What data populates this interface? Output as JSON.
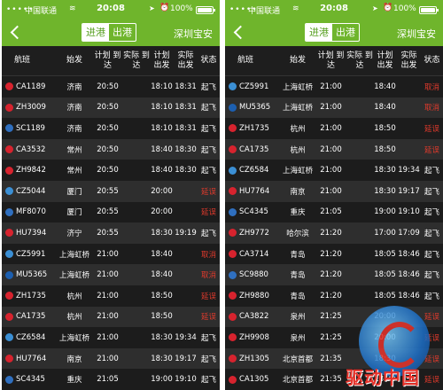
{
  "statusbar": {
    "signal": "•••••",
    "carrier": "中国联通",
    "wifi": "≋",
    "time": "20:08",
    "location": "➤",
    "alarm": "⏰",
    "battery": "100%",
    "battery_level": 1.0
  },
  "nav": {
    "tab_arrive": "进港",
    "tab_depart": "出港",
    "airport": "深圳宝安"
  },
  "columns": {
    "flight": "航班",
    "origin": "始发",
    "sched_arr": "计划 到达",
    "actual_arr": "实际 到达",
    "sched_dep": "计划 出发",
    "actual_dep": "实际 出发",
    "status": "状态"
  },
  "airline_colors": {
    "CA": "#d7232e",
    "ZH": "#d7232e",
    "SC": "#2f6fbf",
    "CZ": "#3b8fd4",
    "MF": "#2f6fbf",
    "HU": "#d7232e",
    "MU": "#1c5fb0"
  },
  "left_flights": [
    {
      "flight": "CA1189",
      "origin": "济南",
      "sched_arr": "20:50",
      "actual_arr": "",
      "sched_dep": "18:10",
      "actual_dep": "18:31",
      "status": "起飞",
      "status_color": "white",
      "airline": "CA"
    },
    {
      "flight": "ZH3009",
      "origin": "济南",
      "sched_arr": "20:50",
      "actual_arr": "",
      "sched_dep": "18:10",
      "actual_dep": "18:31",
      "status": "起飞",
      "status_color": "white",
      "airline": "ZH"
    },
    {
      "flight": "SC1189",
      "origin": "济南",
      "sched_arr": "20:50",
      "actual_arr": "",
      "sched_dep": "18:10",
      "actual_dep": "18:31",
      "status": "起飞",
      "status_color": "white",
      "airline": "SC"
    },
    {
      "flight": "CA3532",
      "origin": "常州",
      "sched_arr": "20:50",
      "actual_arr": "",
      "sched_dep": "18:40",
      "actual_dep": "18:30",
      "status": "起飞",
      "status_color": "white",
      "airline": "CA"
    },
    {
      "flight": "ZH9842",
      "origin": "常州",
      "sched_arr": "20:50",
      "actual_arr": "",
      "sched_dep": "18:40",
      "actual_dep": "18:30",
      "status": "起飞",
      "status_color": "white",
      "airline": "ZH"
    },
    {
      "flight": "CZ5044",
      "origin": "厦门",
      "sched_arr": "20:55",
      "actual_arr": "",
      "sched_dep": "20:00",
      "actual_dep": "",
      "status": "延误",
      "status_color": "red",
      "airline": "CZ"
    },
    {
      "flight": "MF8070",
      "origin": "厦门",
      "sched_arr": "20:55",
      "actual_arr": "",
      "sched_dep": "20:00",
      "actual_dep": "",
      "status": "延误",
      "status_color": "red",
      "airline": "MF"
    },
    {
      "flight": "HU7394",
      "origin": "济宁",
      "sched_arr": "20:55",
      "actual_arr": "",
      "sched_dep": "18:30",
      "actual_dep": "19:19",
      "status": "起飞",
      "status_color": "white",
      "airline": "HU"
    },
    {
      "flight": "CZ5991",
      "origin": "上海虹桥",
      "sched_arr": "21:00",
      "actual_arr": "",
      "sched_dep": "18:40",
      "actual_dep": "",
      "status": "取消",
      "status_color": "red",
      "airline": "CZ"
    },
    {
      "flight": "MU5365",
      "origin": "上海虹桥",
      "sched_arr": "21:00",
      "actual_arr": "",
      "sched_dep": "18:40",
      "actual_dep": "",
      "status": "取消",
      "status_color": "red",
      "airline": "MU"
    },
    {
      "flight": "ZH1735",
      "origin": "杭州",
      "sched_arr": "21:00",
      "actual_arr": "",
      "sched_dep": "18:50",
      "actual_dep": "",
      "status": "延误",
      "status_color": "red",
      "airline": "ZH"
    },
    {
      "flight": "CA1735",
      "origin": "杭州",
      "sched_arr": "21:00",
      "actual_arr": "",
      "sched_dep": "18:50",
      "actual_dep": "",
      "status": "延误",
      "status_color": "red",
      "airline": "CA"
    },
    {
      "flight": "CZ6584",
      "origin": "上海虹桥",
      "sched_arr": "21:00",
      "actual_arr": "",
      "sched_dep": "18:30",
      "actual_dep": "19:34",
      "status": "起飞",
      "status_color": "white",
      "airline": "CZ"
    },
    {
      "flight": "HU7764",
      "origin": "南京",
      "sched_arr": "21:00",
      "actual_arr": "",
      "sched_dep": "18:30",
      "actual_dep": "19:17",
      "status": "起飞",
      "status_color": "white",
      "airline": "HU"
    },
    {
      "flight": "SC4345",
      "origin": "重庆",
      "sched_arr": "21:05",
      "actual_arr": "",
      "sched_dep": "19:00",
      "actual_dep": "19:10",
      "status": "起飞",
      "status_color": "white",
      "airline": "SC"
    }
  ],
  "right_flights": [
    {
      "flight": "CZ5991",
      "origin": "上海虹桥",
      "sched_arr": "21:00",
      "actual_arr": "",
      "sched_dep": "18:40",
      "actual_dep": "",
      "status": "取消",
      "status_color": "red",
      "airline": "CZ"
    },
    {
      "flight": "MU5365",
      "origin": "上海虹桥",
      "sched_arr": "21:00",
      "actual_arr": "",
      "sched_dep": "18:40",
      "actual_dep": "",
      "status": "取消",
      "status_color": "red",
      "airline": "MU"
    },
    {
      "flight": "ZH1735",
      "origin": "杭州",
      "sched_arr": "21:00",
      "actual_arr": "",
      "sched_dep": "18:50",
      "actual_dep": "",
      "status": "延误",
      "status_color": "red",
      "airline": "ZH"
    },
    {
      "flight": "CA1735",
      "origin": "杭州",
      "sched_arr": "21:00",
      "actual_arr": "",
      "sched_dep": "18:50",
      "actual_dep": "",
      "status": "延误",
      "status_color": "red",
      "airline": "CA"
    },
    {
      "flight": "CZ6584",
      "origin": "上海虹桥",
      "sched_arr": "21:00",
      "actual_arr": "",
      "sched_dep": "18:30",
      "actual_dep": "19:34",
      "status": "起飞",
      "status_color": "white",
      "airline": "CZ"
    },
    {
      "flight": "HU7764",
      "origin": "南京",
      "sched_arr": "21:00",
      "actual_arr": "",
      "sched_dep": "18:30",
      "actual_dep": "19:17",
      "status": "起飞",
      "status_color": "white",
      "airline": "HU"
    },
    {
      "flight": "SC4345",
      "origin": "重庆",
      "sched_arr": "21:05",
      "actual_arr": "",
      "sched_dep": "19:00",
      "actual_dep": "19:10",
      "status": "起飞",
      "status_color": "white",
      "airline": "SC"
    },
    {
      "flight": "ZH9772",
      "origin": "哈尔滨",
      "sched_arr": "21:20",
      "actual_arr": "",
      "sched_dep": "17:00",
      "actual_dep": "17:09",
      "status": "起飞",
      "status_color": "white",
      "airline": "ZH"
    },
    {
      "flight": "CA3714",
      "origin": "青岛",
      "sched_arr": "21:20",
      "actual_arr": "",
      "sched_dep": "18:05",
      "actual_dep": "18:46",
      "status": "起飞",
      "status_color": "white",
      "airline": "CA"
    },
    {
      "flight": "SC9880",
      "origin": "青岛",
      "sched_arr": "21:20",
      "actual_arr": "",
      "sched_dep": "18:05",
      "actual_dep": "18:46",
      "status": "起飞",
      "status_color": "white",
      "airline": "SC"
    },
    {
      "flight": "ZH9880",
      "origin": "青岛",
      "sched_arr": "21:20",
      "actual_arr": "",
      "sched_dep": "18:05",
      "actual_dep": "18:46",
      "status": "起飞",
      "status_color": "white",
      "airline": "ZH"
    },
    {
      "flight": "CA3822",
      "origin": "泉州",
      "sched_arr": "21:25",
      "actual_arr": "",
      "sched_dep": "20:00",
      "actual_dep": "",
      "status": "延误",
      "status_color": "red",
      "airline": "CA"
    },
    {
      "flight": "ZH9908",
      "origin": "泉州",
      "sched_arr": "21:25",
      "actual_arr": "",
      "sched_dep": "20:00",
      "actual_dep": "",
      "status": "延误",
      "status_color": "red",
      "airline": "ZH"
    },
    {
      "flight": "ZH1305",
      "origin": "北京首都",
      "sched_arr": "21:35",
      "actual_arr": "",
      "sched_dep": "18:30",
      "actual_dep": "",
      "status": "延误",
      "status_color": "red",
      "airline": "ZH"
    },
    {
      "flight": "CA1305",
      "origin": "北京首都",
      "sched_arr": "21:35",
      "actual_arr": "",
      "sched_dep": "18:30",
      "actual_dep": "",
      "status": "延误",
      "status_color": "red",
      "airline": "CA"
    }
  ],
  "watermark": {
    "text": "驱动中国"
  }
}
